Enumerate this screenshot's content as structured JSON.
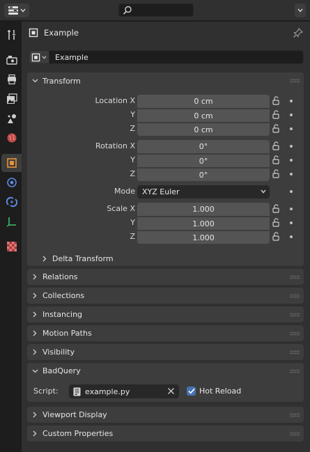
{
  "header": {
    "editor_icon": "properties-editor-icon",
    "search_placeholder": ""
  },
  "tabs": [
    {
      "name": "tool-tab",
      "icon": "wrench-screwdriver-icon",
      "active": false
    },
    {
      "name": "render-tab",
      "icon": "camera-back-icon",
      "active": false
    },
    {
      "name": "output-tab",
      "icon": "printer-icon",
      "active": false
    },
    {
      "name": "view-layer-tab",
      "icon": "image-stack-icon",
      "active": false
    },
    {
      "name": "scene-tab",
      "icon": "scene-icon",
      "active": false
    },
    {
      "name": "world-tab",
      "icon": "globe-icon",
      "active": false
    },
    {
      "name": "object-tab",
      "icon": "object-square-icon",
      "active": true
    },
    {
      "name": "modifiers-tab",
      "icon": "physics-icon",
      "active": false
    },
    {
      "name": "constraints-tab",
      "icon": "constraint-icon",
      "active": false
    },
    {
      "name": "data-tab",
      "icon": "axis-icon",
      "active": false
    },
    {
      "name": "texture-tab",
      "icon": "checker-icon",
      "active": false
    }
  ],
  "context": {
    "object_name": "Example",
    "datablock_name": "Example"
  },
  "transform": {
    "title": "Transform",
    "location": {
      "labels": [
        "Location X",
        "Y",
        "Z"
      ],
      "values": [
        "0 cm",
        "0 cm",
        "0 cm"
      ]
    },
    "rotation": {
      "labels": [
        "Rotation X",
        "Y",
        "Z"
      ],
      "values": [
        "0°",
        "0°",
        "0°"
      ]
    },
    "mode": {
      "label": "Mode",
      "value": "XYZ Euler"
    },
    "scale": {
      "labels": [
        "Scale X",
        "Y",
        "Z"
      ],
      "values": [
        "1.000",
        "1.000",
        "1.000"
      ]
    },
    "delta_title": "Delta Transform"
  },
  "panels": {
    "relations": "Relations",
    "collections": "Collections",
    "instancing": "Instancing",
    "motion_paths": "Motion Paths",
    "visibility": "Visibility",
    "badquery": "BadQuery",
    "viewport_display": "Viewport Display",
    "custom_properties": "Custom Properties"
  },
  "badquery": {
    "script_label": "Script:",
    "script_file": "example.py",
    "hot_reload_label": "Hot Reload",
    "hot_reload_checked": true
  },
  "colors": {
    "accent": "#4772b3",
    "panel": "#3d3d3d",
    "field": "#545454",
    "background": "#303030"
  }
}
